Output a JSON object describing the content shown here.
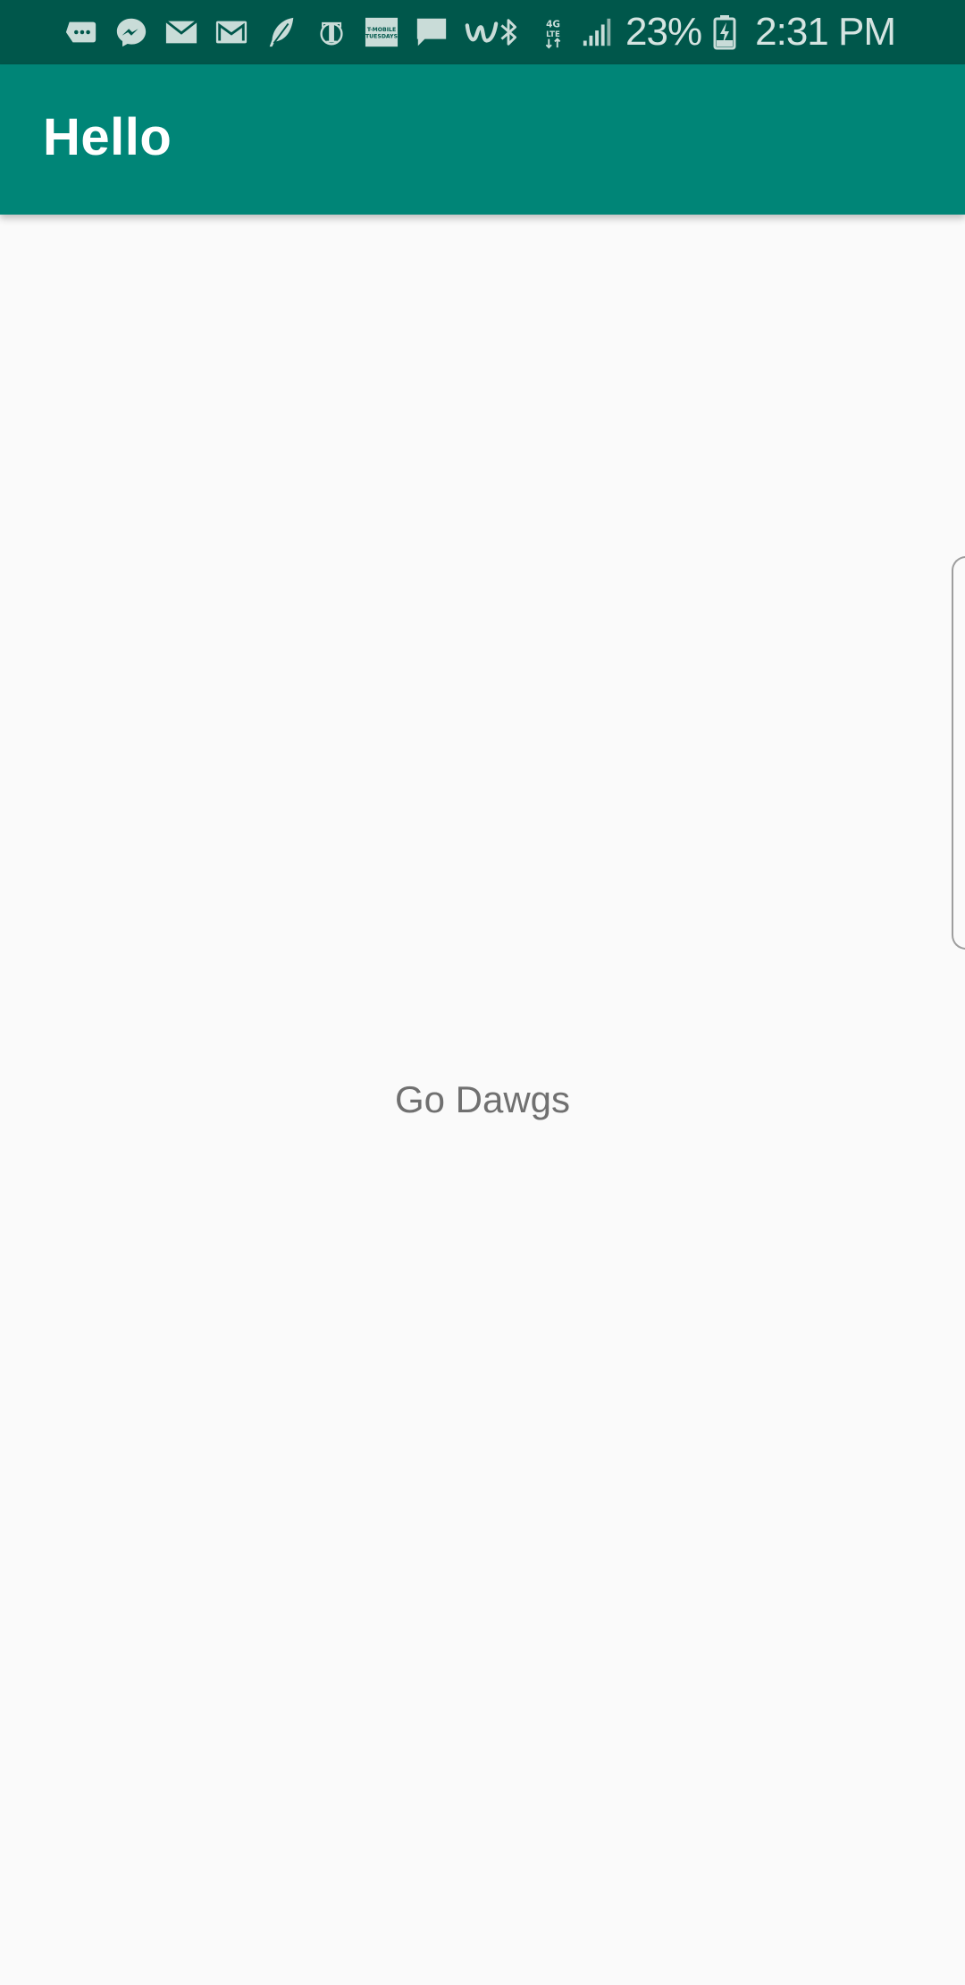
{
  "status_bar": {
    "left_icons": [
      "message-bubble-icon",
      "messenger-icon",
      "email-icon",
      "gmail-icon",
      "feather-icon",
      "nytimes-icon",
      "tmobile-tuesdays-icon",
      "chat-icon",
      "wish-icon"
    ],
    "tmobile_label": "T-MOBILE TUESDAYS",
    "right_icons": [
      "bluetooth-icon",
      "4g-lte-icon",
      "signal-icon"
    ],
    "network_label": "4G LTE",
    "battery_percent": "23%",
    "time": "2:31 PM",
    "colors": {
      "background": "#00574b",
      "icon": "#c9dcd8"
    }
  },
  "app_bar": {
    "title": "Hello",
    "color": "#008577"
  },
  "main": {
    "center_text": "Go Dawgs",
    "background": "#fafafa"
  }
}
